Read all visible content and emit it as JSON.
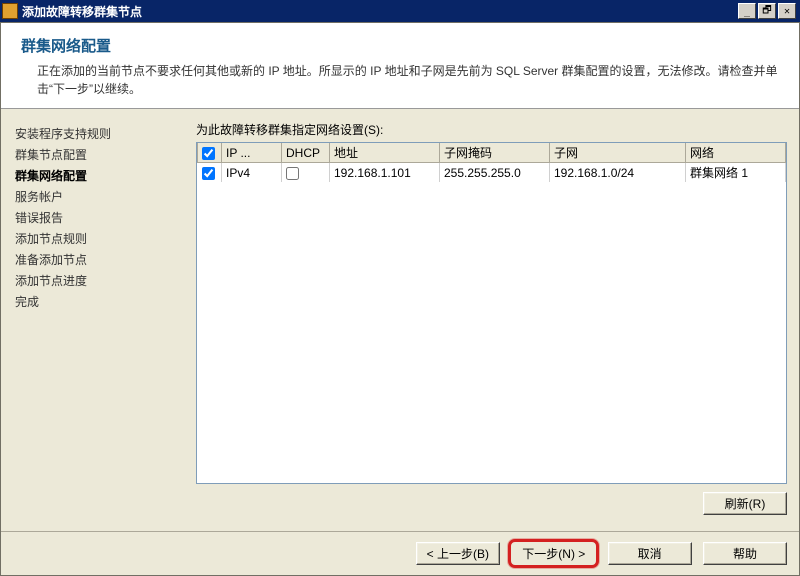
{
  "window": {
    "title": "添加故障转移群集节点"
  },
  "header": {
    "title": "群集网络配置",
    "description": "正在添加的当前节点不要求任何其他或新的 IP 地址。所显示的 IP 地址和子网是先前为 SQL Server 群集配置的设置，无法修改。请检查并单击“下一步”以继续。"
  },
  "sidebar": {
    "items": [
      {
        "label": "安装程序支持规则",
        "active": false
      },
      {
        "label": "群集节点配置",
        "active": false
      },
      {
        "label": "群集网络配置",
        "active": true
      },
      {
        "label": "服务帐户",
        "active": false
      },
      {
        "label": "错误报告",
        "active": false
      },
      {
        "label": "添加节点规则",
        "active": false
      },
      {
        "label": "准备添加节点",
        "active": false
      },
      {
        "label": "添加节点进度",
        "active": false
      },
      {
        "label": "完成",
        "active": false
      }
    ]
  },
  "table": {
    "caption": "为此故障转移群集指定网络设置(S):",
    "columns": {
      "check": "",
      "ip": "IP ...",
      "dhcp": "DHCP",
      "addr": "地址",
      "mask": "子网掩码",
      "subnet": "子网",
      "net": "网络"
    },
    "rows": [
      {
        "checked": true,
        "ip": "IPv4",
        "dhcp": false,
        "addr": "192.168.1.101",
        "mask": "255.255.255.0",
        "subnet": "192.168.1.0/24",
        "net": "群集网络 1"
      }
    ]
  },
  "buttons": {
    "refresh": "刷新(R)",
    "back": "< 上一步(B)",
    "next": "下一步(N) >",
    "cancel": "取消",
    "help": "帮助"
  },
  "win_controls": {
    "min": "_",
    "max": "🗗",
    "close": "✕"
  }
}
